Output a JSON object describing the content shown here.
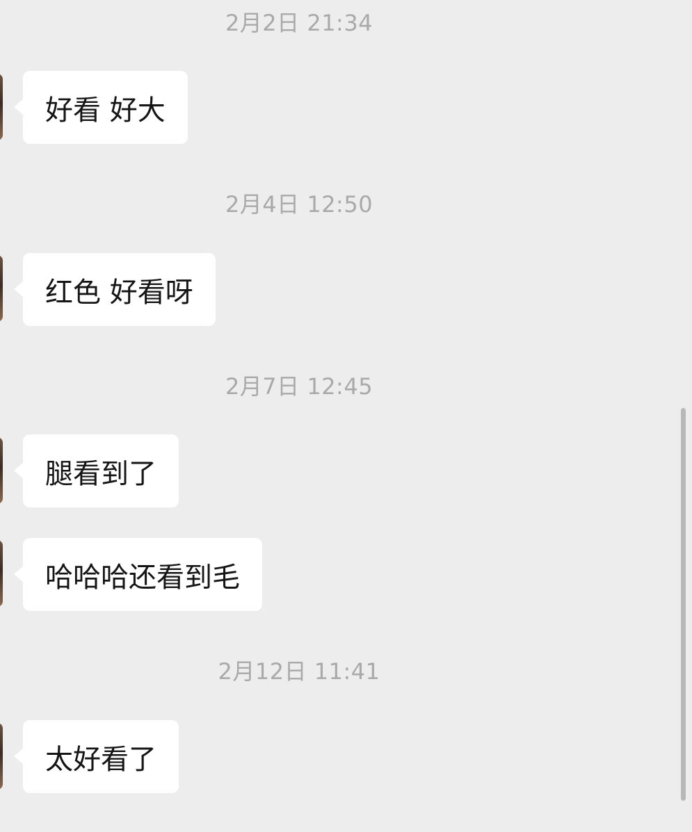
{
  "messages": [
    {
      "time": "2月2日 21:34",
      "text": "好看 好大"
    },
    {
      "time": "2月4日 12:50",
      "text": "红色 好看呀"
    },
    {
      "time": "2月7日 12:45",
      "text": "腿看到了"
    },
    {
      "time": "",
      "text": "哈哈哈还看到毛"
    },
    {
      "time": "2月12日 11:41",
      "text": "太好看了"
    }
  ],
  "colors": {
    "background": "#ededed",
    "bubble": "#ffffff",
    "timestamp": "#a9a9a9",
    "message_text": "#151515",
    "scrollbar": "#b8b8b8"
  }
}
